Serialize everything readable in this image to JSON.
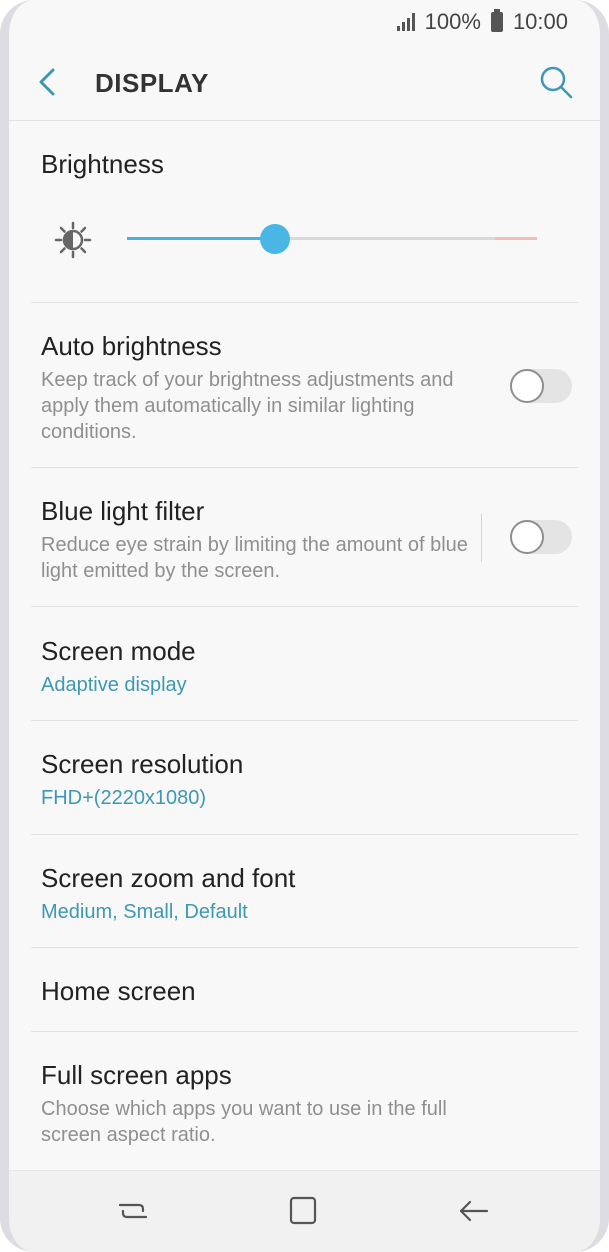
{
  "status_bar": {
    "battery": "100%",
    "time": "10:00"
  },
  "app_bar": {
    "title": "DISPLAY"
  },
  "brightness": {
    "title": "Brightness",
    "level_percent": 36
  },
  "settings": {
    "auto_brightness": {
      "title": "Auto brightness",
      "description": "Keep track of your brightness adjustments and apply them automatically in similar lighting conditions.",
      "enabled": false
    },
    "blue_light_filter": {
      "title": "Blue light filter",
      "description": "Reduce eye strain by limiting the amount of blue light emitted by the screen.",
      "enabled": false
    },
    "screen_mode": {
      "title": "Screen mode",
      "value": "Adaptive display"
    },
    "screen_resolution": {
      "title": "Screen resolution",
      "value": "FHD+(2220x1080)"
    },
    "screen_zoom": {
      "title": "Screen zoom and font",
      "value": "Medium, Small, Default"
    },
    "home_screen": {
      "title": "Home screen"
    },
    "full_screen_apps": {
      "title": "Full screen apps",
      "description": "Choose which apps you want to use in the full screen aspect ratio."
    }
  },
  "colors": {
    "accent": "#3e98b5",
    "slider": "#49b6e6"
  },
  "icons": {
    "back": "back-arrow-icon",
    "search": "search-icon",
    "brightness": "brightness-icon",
    "recents": "recent-apps-icon",
    "home": "home-icon",
    "nav_back": "back-icon"
  }
}
